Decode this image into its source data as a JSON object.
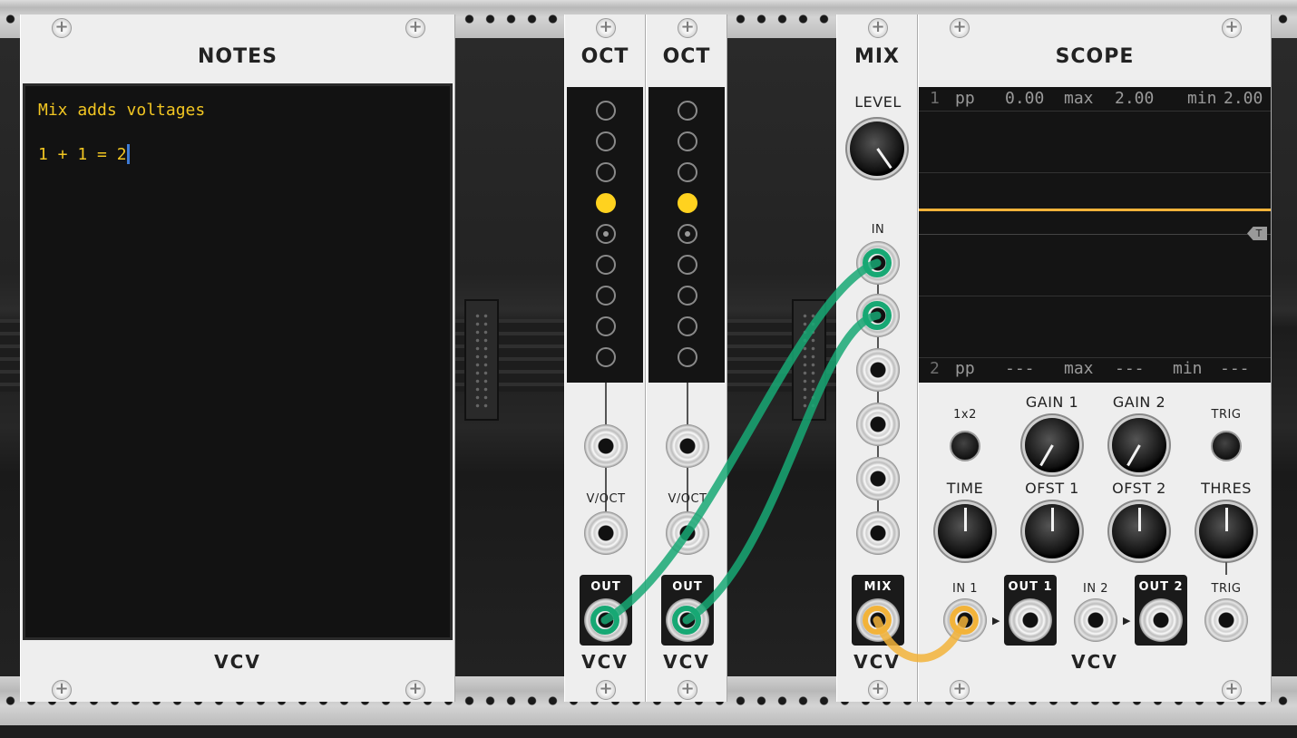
{
  "notes": {
    "title": "NOTES",
    "line1": "Mix adds voltages",
    "line2": "1 + 1 = 2",
    "brand": "VCV"
  },
  "oct1": {
    "title": "OCT",
    "input_label": "V/OCT",
    "output_label": "OUT",
    "active_step": 4,
    "brand": "VCV"
  },
  "oct2": {
    "title": "OCT",
    "input_label": "V/OCT",
    "output_label": "OUT",
    "active_step": 4,
    "brand": "VCV"
  },
  "mix": {
    "title": "MIX",
    "level_label": "LEVEL",
    "in_label": "IN",
    "out_label": "MIX",
    "brand": "VCV"
  },
  "scope": {
    "title": "SCOPE",
    "ch1": {
      "num": "1",
      "pp_label": "pp",
      "pp": "0.00",
      "max_label": "max",
      "max": "2.00",
      "min_label": "min",
      "min": "2.00"
    },
    "ch2": {
      "num": "2",
      "pp_label": "pp",
      "pp": "---",
      "max_label": "max",
      "max": "---",
      "min_label": "min",
      "min": "---"
    },
    "trigger_marker": "T",
    "labels": {
      "mode": "1x2",
      "gain1": "GAIN 1",
      "gain2": "GAIN 2",
      "trig_btn": "TRIG",
      "time": "TIME",
      "ofst1": "OFST 1",
      "ofst2": "OFST 2",
      "thres": "THRES",
      "in1": "IN 1",
      "out1": "OUT 1",
      "in2": "IN 2",
      "out2": "OUT 2",
      "trig": "TRIG"
    },
    "brand": "VCV"
  },
  "colors": {
    "cable_green": "#17a874",
    "cable_yellow": "#f2b33a",
    "led_on": "#ffd21f",
    "trace": "#f2b33a"
  }
}
